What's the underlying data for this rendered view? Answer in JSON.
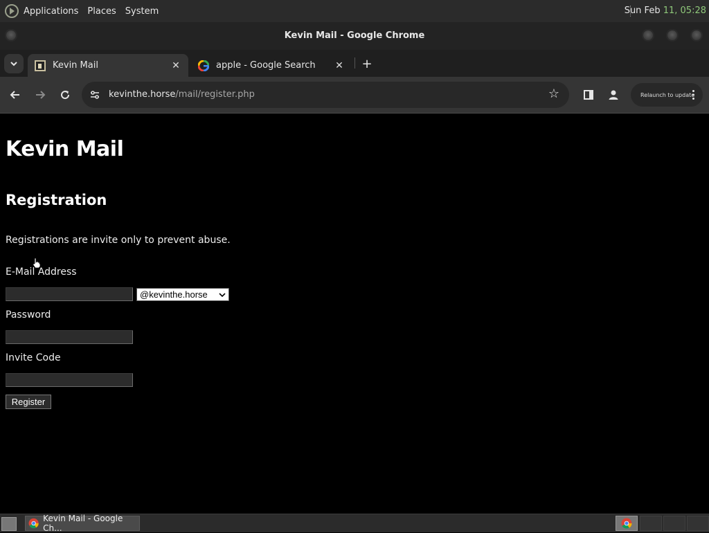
{
  "system_panel": {
    "menus": [
      "Applications",
      "Places",
      "System"
    ],
    "date": "Sun Feb",
    "time": "11, 05:28"
  },
  "window": {
    "title": "Kevin Mail - Google Chrome"
  },
  "tabs": [
    {
      "label": "Kevin Mail",
      "active": true,
      "favicon": "kevin-favicon"
    },
    {
      "label": "apple - Google Search",
      "active": false,
      "favicon": "google-g-icon"
    }
  ],
  "toolbar": {
    "url_host": "kevinthe.horse",
    "url_path": "/mail/register.php",
    "relaunch_label": "Relaunch to update"
  },
  "page": {
    "site_title": "Kevin Mail",
    "heading": "Registration",
    "note": "Registrations are invite only to prevent abuse.",
    "email_label": "E-Mail Address",
    "email_value": "",
    "domain_selected": "@kevinthe.horse",
    "password_label": "Password",
    "invite_label": "Invite Code",
    "register_label": "Register"
  },
  "taskbar": {
    "task_label": "Kevin Mail - Google Ch..."
  },
  "colors": {
    "page_bg": "#000000",
    "panel_bg": "#2b2b2b",
    "toolbar_bg": "#353535",
    "clock_accent": "#8fc87a"
  }
}
